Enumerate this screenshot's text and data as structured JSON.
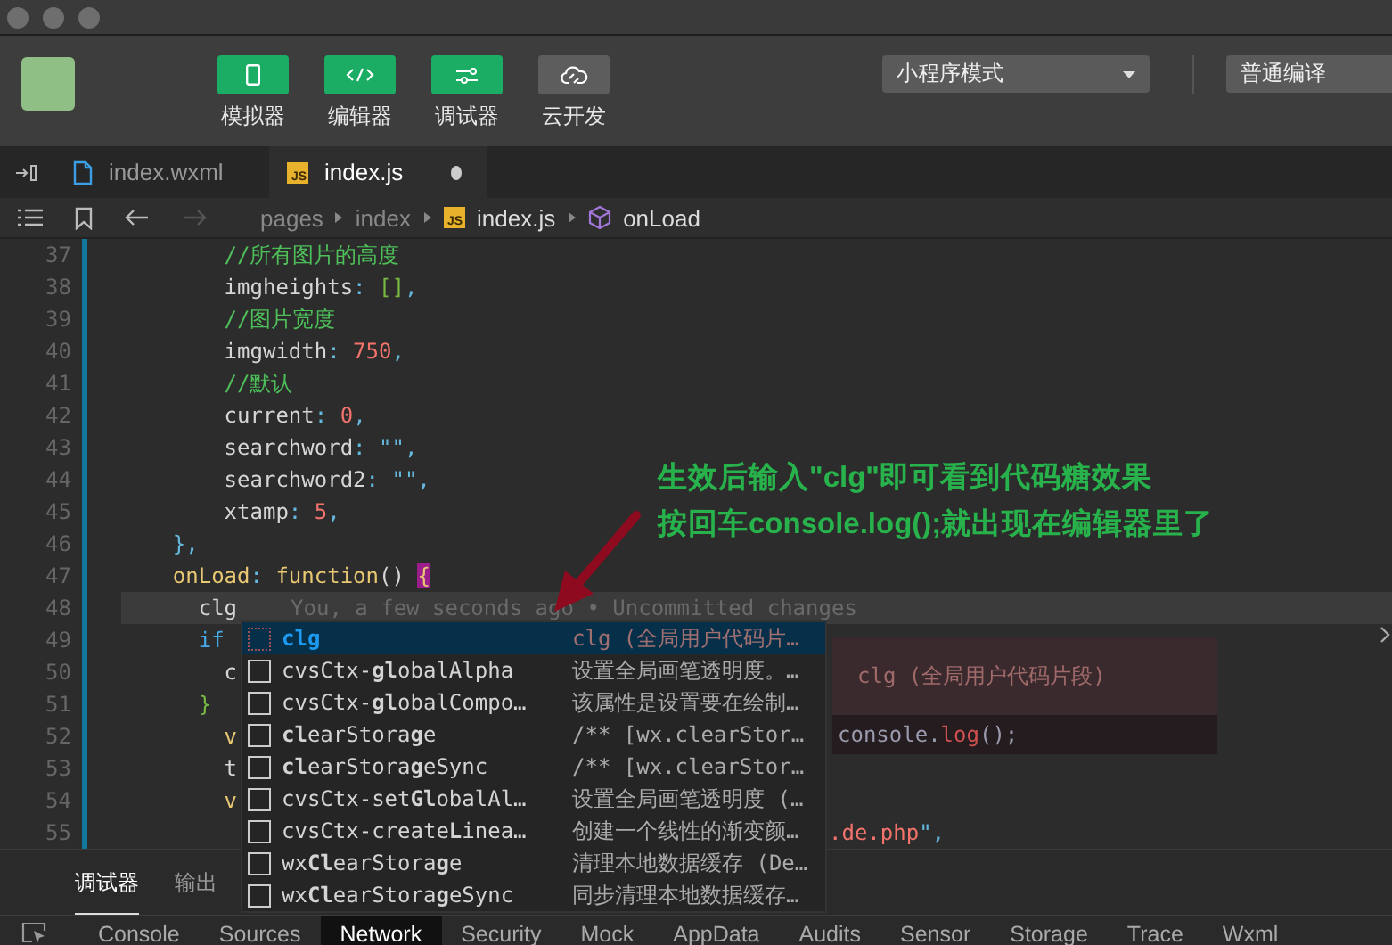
{
  "toolbar": {
    "buttons": [
      {
        "label": "模拟器",
        "on": true
      },
      {
        "label": "编辑器",
        "on": true
      },
      {
        "label": "调试器",
        "on": true
      },
      {
        "label": "云开发",
        "on": false
      }
    ],
    "mode_select": {
      "value": "小程序模式"
    },
    "compile_select": {
      "value": "普通编译"
    }
  },
  "tabs": [
    {
      "label": "index.wxml",
      "selected": false,
      "modified": false
    },
    {
      "label": "index.js",
      "badge": "JS",
      "selected": true,
      "modified": true
    }
  ],
  "breadcrumb": [
    {
      "label": "pages"
    },
    {
      "label": "index"
    },
    {
      "label": "index.js",
      "badge": "JS"
    },
    {
      "label": "onLoad"
    }
  ],
  "code_lines": [
    {
      "number": "37",
      "current": false,
      "tokens": [
        {
          "kind": "comment",
          "text": "        //所有图片的高度"
        }
      ]
    },
    {
      "number": "38",
      "current": false,
      "tokens": [
        {
          "kind": "prop",
          "text": "        imgheights"
        },
        {
          "kind": "punct",
          "text": ": "
        },
        {
          "kind": "bracket",
          "text": "[]"
        },
        {
          "kind": "punct",
          "text": ","
        }
      ]
    },
    {
      "number": "39",
      "current": false,
      "tokens": [
        {
          "kind": "comment",
          "text": "        //图片宽度"
        }
      ]
    },
    {
      "number": "40",
      "current": false,
      "tokens": [
        {
          "kind": "prop",
          "text": "        imgwidth"
        },
        {
          "kind": "punct",
          "text": ": "
        },
        {
          "kind": "number",
          "text": "750"
        },
        {
          "kind": "punct",
          "text": ","
        }
      ]
    },
    {
      "number": "41",
      "current": false,
      "tokens": [
        {
          "kind": "comment",
          "text": "        //默认"
        }
      ]
    },
    {
      "number": "42",
      "current": false,
      "tokens": [
        {
          "kind": "prop",
          "text": "        current"
        },
        {
          "kind": "punct",
          "text": ": "
        },
        {
          "kind": "number",
          "text": "0"
        },
        {
          "kind": "punct",
          "text": ","
        }
      ]
    },
    {
      "number": "43",
      "current": false,
      "tokens": [
        {
          "kind": "prop",
          "text": "        searchword"
        },
        {
          "kind": "punct",
          "text": ": \"\","
        }
      ]
    },
    {
      "number": "44",
      "current": false,
      "tokens": [
        {
          "kind": "prop",
          "text": "        searchword2"
        },
        {
          "kind": "punct",
          "text": ": \"\","
        }
      ]
    },
    {
      "number": "45",
      "current": false,
      "tokens": [
        {
          "kind": "prop",
          "text": "        xtamp"
        },
        {
          "kind": "punct",
          "text": ": "
        },
        {
          "kind": "number",
          "text": "5"
        },
        {
          "kind": "punct",
          "text": ","
        }
      ]
    },
    {
      "number": "46",
      "current": false,
      "tokens": [
        {
          "kind": "punct",
          "text": "    },"
        }
      ]
    },
    {
      "number": "47",
      "current": false,
      "tokens": [
        {
          "kind": "func",
          "text": "    onLoad"
        },
        {
          "kind": "punct",
          "text": ": "
        },
        {
          "kind": "func",
          "text": "function"
        },
        {
          "kind": "prop",
          "text": "() "
        },
        {
          "kind": "match",
          "text": "{"
        }
      ]
    },
    {
      "number": "48",
      "current": true,
      "tokens": [
        {
          "kind": "prop",
          "text": "      clg"
        },
        {
          "kind": "blame",
          "text": "You, a few seconds ago • Uncommitted changes"
        }
      ]
    },
    {
      "number": "49",
      "current": false,
      "tokens": [
        {
          "kind": "keyword",
          "text": "      if"
        }
      ]
    },
    {
      "number": "50",
      "current": false,
      "tokens": [
        {
          "kind": "prop",
          "text": "        c"
        }
      ]
    },
    {
      "number": "51",
      "current": false,
      "tokens": [
        {
          "kind": "bracket",
          "text": "      }"
        }
      ]
    },
    {
      "number": "52",
      "current": false,
      "tokens": [
        {
          "kind": "func",
          "text": "        v"
        }
      ]
    },
    {
      "number": "53",
      "current": false,
      "tokens": [
        {
          "kind": "prop",
          "text": "        t"
        }
      ]
    },
    {
      "number": "54",
      "current": false,
      "tokens": [
        {
          "kind": "func",
          "text": "        v"
        }
      ]
    },
    {
      "number": "55",
      "current": false,
      "tokens": [
        {
          "kind": "number",
          "text": ".de.php"
        },
        {
          "kind": "punct",
          "text": "\","
        }
      ]
    }
  ],
  "suggestions": [
    {
      "label": "**clg**",
      "detail": "clg (全局用户代码片…",
      "selected": true
    },
    {
      "label": "cvsCtx-**gl**obalAlpha",
      "detail": "设置全局画笔透明度。…",
      "selected": false
    },
    {
      "label": "cvsCtx-**gl**obalCompo…",
      "detail": "该属性是设置要在绘制…",
      "selected": false
    },
    {
      "label": "**cl**earStora**g**e",
      "detail": "/** [wx.clearStor…",
      "selected": false
    },
    {
      "label": "**cl**earStora**g**eSync",
      "detail": "/** [wx.clearStor…",
      "selected": false
    },
    {
      "label": "cvsCtx-set**Gl**obalAl…",
      "detail": "设置全局画笔透明度 (…",
      "selected": false
    },
    {
      "label": "cvsCtx-create**L**inea…",
      "detail": "创建一个线性的渐变颜…",
      "selected": false
    },
    {
      "label": "wx**Cl**earStora**g**e",
      "detail": "清理本地数据缓存 (De…",
      "selected": false
    },
    {
      "label": "wx**Cl**earStora**g**eSync",
      "detail": "同步清理本地数据缓存…",
      "selected": false
    }
  ],
  "suggestion_doc": {
    "title": "clg (全局用户代码片段)",
    "code": [
      {
        "kind": "prop",
        "text": "console."
      },
      {
        "kind": "number",
        "text": "log"
      },
      {
        "kind": "prop",
        "text": "();"
      }
    ]
  },
  "annotation": {
    "lines": [
      "生效后输入\"clg\"即可看到代码糖效果",
      "按回车console.log();就出现在编辑器里了"
    ]
  },
  "panel_tabs": [
    {
      "label": "调试器",
      "selected": true
    },
    {
      "label": "输出",
      "selected": false
    }
  ],
  "devtools_tabs": [
    {
      "label": "Console",
      "selected": false
    },
    {
      "label": "Sources",
      "selected": false
    },
    {
      "label": "Network",
      "selected": true
    },
    {
      "label": "Security",
      "selected": false
    },
    {
      "label": "Mock",
      "selected": false
    },
    {
      "label": "AppData",
      "selected": false
    },
    {
      "label": "Audits",
      "selected": false
    },
    {
      "label": "Sensor",
      "selected": false
    },
    {
      "label": "Storage",
      "selected": false
    },
    {
      "label": "Trace",
      "selected": false
    },
    {
      "label": "Wxml",
      "selected": false
    }
  ]
}
